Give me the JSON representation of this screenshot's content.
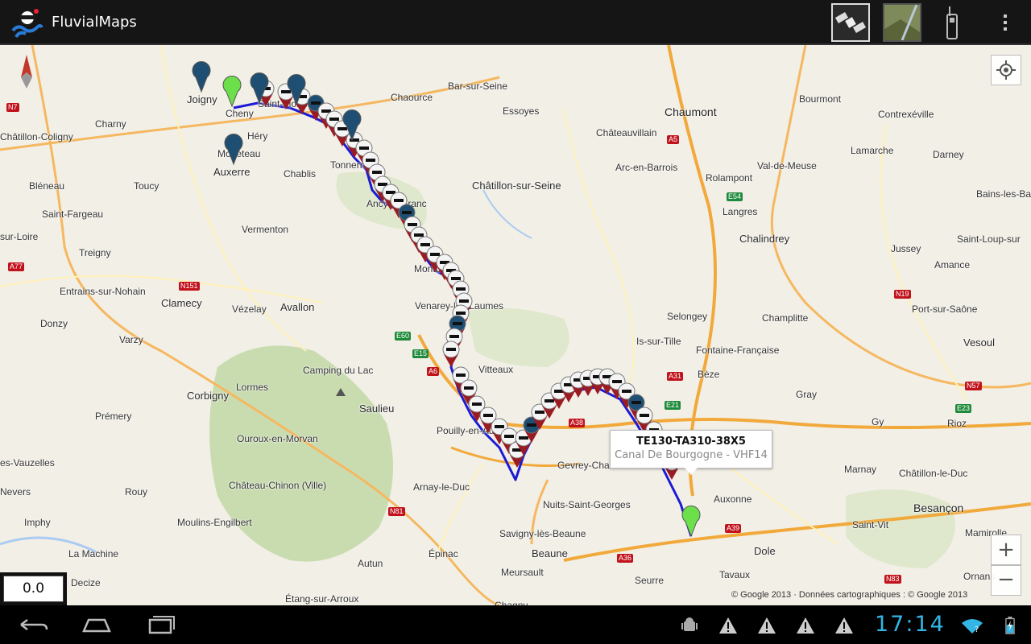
{
  "app": {
    "title": "FluvialMaps"
  },
  "actionbar": {
    "satellite_icon": "satellite-icon",
    "terrain_icon": "terrain-view-icon",
    "radio_icon": "vhf-radio-icon",
    "overflow_icon": "overflow-menu-icon"
  },
  "map": {
    "towns": [
      "Joigny",
      "Cheny",
      "Saint-Florentin",
      "Héry",
      "Monéteau",
      "Auxerre",
      "Charny",
      "Châtillon-Coligny",
      "Chaource",
      "Bar-sur-Seine",
      "Essoyes",
      "Chaumont",
      "Bourmont",
      "Contrexéville",
      "Châteauvillain",
      "Lamarche",
      "Darney",
      "Arc-en-Barrois",
      "Rolampont",
      "Val-de-Meuse",
      "Bains-les-Ba",
      "Langres",
      "Chalindrey",
      "Saint-Loup-sur",
      "Jussey",
      "Amance",
      "Châtillon-sur-Seine",
      "Tonnerre",
      "Chablis",
      "Bléneau",
      "Toucy",
      "Saint-Fargeau",
      "sur-Loire",
      "Ancy-le-Franc",
      "Vermenton",
      "Treigny",
      "Montbard",
      "Entrains-sur-Nohain",
      "Clamecy",
      "Vézelay",
      "Avallon",
      "Venarey-les-Laumes",
      "Donzy",
      "Varzy",
      "Selongey",
      "Champlitte",
      "Port-sur-Saône",
      "Is-sur-Tille",
      "Fontaine-Française",
      "Vesoul",
      "Camping du Lac",
      "Lormes",
      "Saulieu",
      "Vitteaux",
      "Bèze",
      "Gray",
      "Corbigny",
      "Prémery",
      "Ouroux-en-Morvan",
      "Pouilly-en-Auxois",
      "Gy",
      "Rioz",
      "Gevrey-Chambertin",
      "Marnay",
      "Châtillon-le-Duc",
      "es-Vauzelles",
      "Nevers",
      "Rouy",
      "Château-Chinon (Ville)",
      "Arnay-le-Duc",
      "Nuits-Saint-Georges",
      "Auxonne",
      "Besançon",
      "Imphy",
      "Moulins-Engilbert",
      "Savigny-lès-Beaune",
      "Saint-Vit",
      "Mamirolle",
      "La Machine",
      "Épinac",
      "Beaune",
      "Dole",
      "Autun",
      "Meursault",
      "Tavaux",
      "Decize",
      "Seurre",
      "Ornans",
      "Étang-sur-Arroux",
      "Chagny"
    ],
    "roads": [
      "N7",
      "A5",
      "E54",
      "A77",
      "N151",
      "N19",
      "E60",
      "E15",
      "A6",
      "A31",
      "E21",
      "N57",
      "E23",
      "A38",
      "N81",
      "A39",
      "A36",
      "N83"
    ],
    "route_start_marker": "green-pin-icon",
    "route_end_marker": "green-pin-icon",
    "lock_marker": "lock-marker-icon",
    "port_marker": "anchor-marker-icon",
    "popup": {
      "title": "TE130-TA310-38X5",
      "subtitle": "Canal De Bourgogne - VHF14"
    },
    "copyright": "© Google 2013 · Données cartographiques : © Google 2013",
    "speed": "0.0",
    "zoom_in": "+",
    "zoom_out": "−",
    "locate_icon": "my-location-icon",
    "compass_icon": "compass-icon"
  },
  "status": {
    "time": "17:14",
    "notifications": [
      "android-debug-icon",
      "warning-icon",
      "warning-icon",
      "warning-icon",
      "warning-icon"
    ],
    "wifi_icon": "wifi-icon",
    "battery_icon": "battery-charging-icon"
  },
  "colors": {
    "route": "#1b1bd6",
    "accent": "#33b5e5",
    "actionbar": "#151515"
  }
}
